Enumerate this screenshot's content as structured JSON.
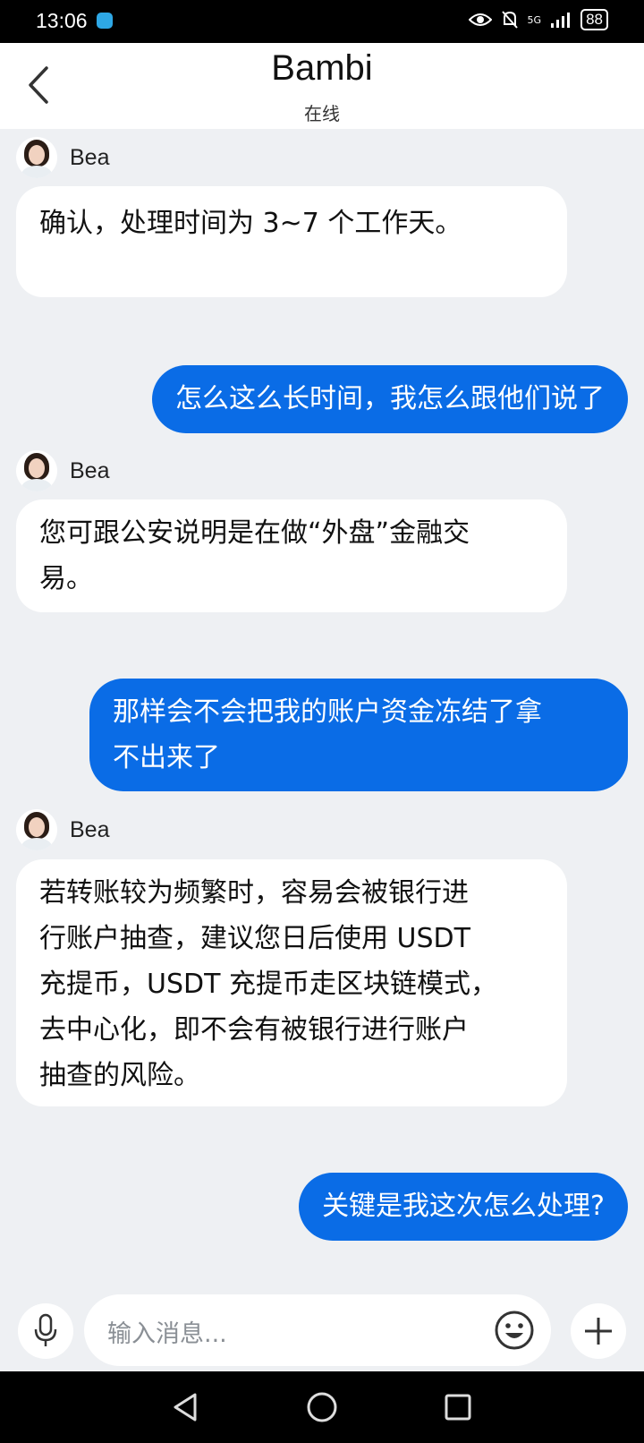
{
  "status_bar": {
    "time": "13:06",
    "network": "5G",
    "battery": "88"
  },
  "header": {
    "title": "Bambi",
    "subtitle": "在线"
  },
  "messages": [
    {
      "sender": "Bea",
      "direction": "in",
      "lines": [
        "确认，处理时间为 3~7 个工作天。"
      ]
    },
    {
      "direction": "out",
      "lines": [
        "怎么这么长时间，我怎么跟他们说了"
      ]
    },
    {
      "sender": "Bea",
      "direction": "in",
      "lines": [
        "您可跟公安说明是在做“外盘”金融交",
        "易。"
      ]
    },
    {
      "direction": "out",
      "lines": [
        "那样会不会把我的账户资金冻结了拿",
        "不出来了"
      ]
    },
    {
      "sender": "Bea",
      "direction": "in",
      "lines": [
        "若转账较为频繁时，容易会被银行进",
        "行账户抽查，建议您日后使用 USDT",
        "充提币，USDT 充提币走区块链模式，",
        "去中心化，即不会有被银行进行账户",
        "抽查的风险。"
      ]
    },
    {
      "direction": "out",
      "lines": [
        "关键是我这次怎么处理?"
      ]
    }
  ],
  "composer": {
    "placeholder": "输入消息..."
  },
  "icons": {
    "back": "chevron-left-icon",
    "mic": "microphone-icon",
    "emoji": "emoji-icon",
    "add": "plus-icon",
    "nav_back": "triangle-back-icon",
    "nav_home": "circle-home-icon",
    "nav_recents": "square-recents-icon"
  },
  "colors": {
    "outgoing_bubble": "#0a6ce6",
    "incoming_bubble": "#ffffff",
    "chat_background": "#eef0f3"
  }
}
